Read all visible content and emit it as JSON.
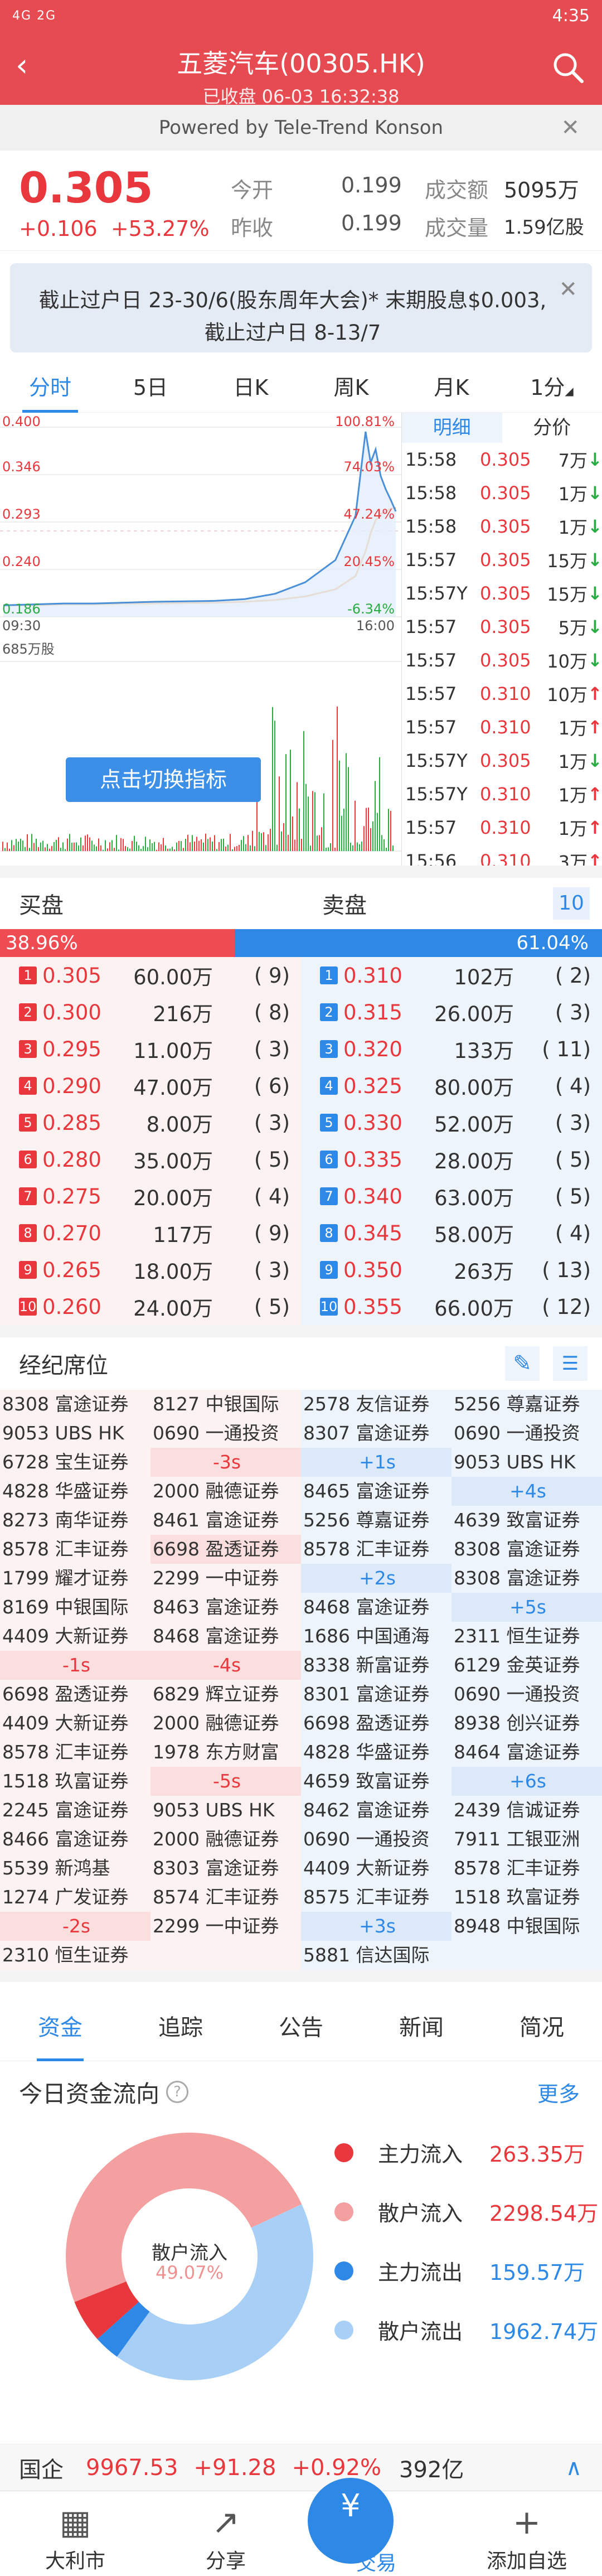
{
  "status_bar": {
    "signal": "4G 2G",
    "time": "4:35"
  },
  "header": {
    "title": "五菱汽车(00305.HK)",
    "subtitle": "已收盘 06-03 16:32:38"
  },
  "powered": {
    "text": "Powered by Tele-Trend Konson"
  },
  "quote": {
    "price": "0.305",
    "change": "+0.106",
    "change_pct": "+53.27%",
    "open_label": "今开",
    "open": "0.199",
    "prev_label": "昨收",
    "prev": "0.199",
    "turnover_label": "成交额",
    "turnover": "5095万",
    "volume_label": "成交量",
    "volume": "1.59亿股"
  },
  "notice": {
    "text": "截止过户日 23-30/6(股东周年大会)* 末期股息$0.003,截止过户日 8-13/7"
  },
  "kline_tabs": [
    "分时",
    "5日",
    "日K",
    "周K",
    "月K",
    "1分"
  ],
  "chart_data": {
    "type": "line",
    "y_labels": [
      "0.400",
      "0.346",
      "0.293",
      "0.240",
      "0.186"
    ],
    "pct_labels": [
      "100.81%",
      "74.03%",
      "47.24%",
      "20.45%",
      "-6.34%"
    ],
    "x_labels": [
      "09:30",
      "16:00"
    ],
    "ylim": [
      0.186,
      0.4
    ],
    "series": [
      {
        "name": "price",
        "color": "#4a90d9",
        "x": [
          "09:30",
          "10:00",
          "10:30",
          "11:00",
          "11:30",
          "12:00",
          "13:00",
          "13:30",
          "14:00",
          "14:30",
          "15:00",
          "15:20",
          "15:30",
          "15:35",
          "15:40",
          "15:45",
          "15:50",
          "15:55",
          "16:00"
        ],
        "values": [
          0.199,
          0.2,
          0.201,
          0.201,
          0.202,
          0.203,
          0.204,
          0.206,
          0.212,
          0.225,
          0.25,
          0.3,
          0.395,
          0.36,
          0.375,
          0.345,
          0.33,
          0.318,
          0.305
        ]
      },
      {
        "name": "avg",
        "color": "#f0a040",
        "x": [
          "09:30",
          "10:00",
          "10:30",
          "11:00",
          "11:30",
          "12:00",
          "13:00",
          "13:30",
          "14:00",
          "14:30",
          "15:00",
          "15:20",
          "15:30",
          "15:35",
          "15:40",
          "15:45",
          "15:50",
          "15:55",
          "16:00"
        ],
        "values": [
          0.199,
          0.199,
          0.2,
          0.2,
          0.201,
          0.201,
          0.202,
          0.203,
          0.205,
          0.209,
          0.217,
          0.232,
          0.26,
          0.28,
          0.295,
          0.302,
          0.305,
          0.308,
          0.309
        ]
      }
    ],
    "volume_label": "685万股"
  },
  "ticks_tabs": {
    "detail": "明细",
    "price": "分价"
  },
  "ticks": [
    {
      "t": "15:58",
      "p": "0.305",
      "v": "7万",
      "d": "↓"
    },
    {
      "t": "15:58",
      "p": "0.305",
      "v": "1万",
      "d": "↓"
    },
    {
      "t": "15:58",
      "p": "0.305",
      "v": "1万",
      "d": "↓"
    },
    {
      "t": "15:57",
      "p": "0.305",
      "v": "15万",
      "d": "↓"
    },
    {
      "t": "15:57Y",
      "p": "0.305",
      "v": "15万",
      "d": "↓"
    },
    {
      "t": "15:57",
      "p": "0.305",
      "v": "5万",
      "d": "↓"
    },
    {
      "t": "15:57",
      "p": "0.305",
      "v": "10万",
      "d": "↓"
    },
    {
      "t": "15:57",
      "p": "0.310",
      "v": "10万",
      "d": "↑"
    },
    {
      "t": "15:57",
      "p": "0.310",
      "v": "1万",
      "d": "↑"
    },
    {
      "t": "15:57Y",
      "p": "0.305",
      "v": "1万",
      "d": "↓"
    },
    {
      "t": "15:57Y",
      "p": "0.310",
      "v": "1万",
      "d": "↑"
    },
    {
      "t": "15:57",
      "p": "0.310",
      "v": "1万",
      "d": "↑"
    },
    {
      "t": "15:56",
      "p": "0.310",
      "v": "3万",
      "d": "↑"
    }
  ],
  "switch_indicator": "点击切换指标",
  "orderbook": {
    "buy_label": "买盘",
    "sell_label": "卖盘",
    "depth": "10",
    "buy_pct": "38.96%",
    "sell_pct": "61.04%",
    "buy_ratio": 0.3896,
    "bids": [
      {
        "lv": "1",
        "price": "0.305",
        "vol": "60.00万",
        "cnt": "9"
      },
      {
        "lv": "2",
        "price": "0.300",
        "vol": "216万",
        "cnt": "8"
      },
      {
        "lv": "3",
        "price": "0.295",
        "vol": "11.00万",
        "cnt": "3"
      },
      {
        "lv": "4",
        "price": "0.290",
        "vol": "47.00万",
        "cnt": "6"
      },
      {
        "lv": "5",
        "price": "0.285",
        "vol": "8.00万",
        "cnt": "3"
      },
      {
        "lv": "6",
        "price": "0.280",
        "vol": "35.00万",
        "cnt": "5"
      },
      {
        "lv": "7",
        "price": "0.275",
        "vol": "20.00万",
        "cnt": "4"
      },
      {
        "lv": "8",
        "price": "0.270",
        "vol": "117万",
        "cnt": "9"
      },
      {
        "lv": "9",
        "price": "0.265",
        "vol": "18.00万",
        "cnt": "3"
      },
      {
        "lv": "10",
        "price": "0.260",
        "vol": "24.00万",
        "cnt": "5"
      }
    ],
    "asks": [
      {
        "lv": "1",
        "price": "0.310",
        "vol": "102万",
        "cnt": "2"
      },
      {
        "lv": "2",
        "price": "0.315",
        "vol": "26.00万",
        "cnt": "3"
      },
      {
        "lv": "3",
        "price": "0.320",
        "vol": "133万",
        "cnt": "11"
      },
      {
        "lv": "4",
        "price": "0.325",
        "vol": "80.00万",
        "cnt": "4"
      },
      {
        "lv": "5",
        "price": "0.330",
        "vol": "52.00万",
        "cnt": "3"
      },
      {
        "lv": "6",
        "price": "0.335",
        "vol": "28.00万",
        "cnt": "5"
      },
      {
        "lv": "7",
        "price": "0.340",
        "vol": "63.00万",
        "cnt": "5"
      },
      {
        "lv": "8",
        "price": "0.345",
        "vol": "58.00万",
        "cnt": "4"
      },
      {
        "lv": "9",
        "price": "0.350",
        "vol": "263万",
        "cnt": "13"
      },
      {
        "lv": "10",
        "price": "0.355",
        "vol": "66.00万",
        "cnt": "12"
      }
    ]
  },
  "brokers": {
    "title": "经纪席位",
    "columns": [
      [
        "8308 富途证券",
        "9053 UBS HK",
        "6728 宝生证券",
        "4828 华盛证券",
        "8273 南华证券",
        "8578 汇丰证券",
        "1799 耀才证券",
        "8169 中银国际",
        "4409 大新证券",
        "-1s",
        "6698 盈透证券",
        "4409 大新证券",
        "8578 汇丰证券",
        "1518 玖富证券",
        "2245 富途证券",
        "8466 富途证券",
        "5539 新鸿基",
        "1274 广发证券",
        "-2s",
        "2310 恒生证券"
      ],
      [
        "8127 中银国际",
        "0690 一通投资",
        "-3s",
        "2000 融德证券",
        "8461 富途证券",
        "6698 盈透证券",
        "2299 一中证券",
        "8463 富途证券",
        "8468 富途证券",
        "-4s",
        "6829 辉立证券",
        "2000 融德证券",
        "1978 东方财富",
        "-5s",
        "9053 UBS HK",
        "2000 融德证券",
        "8303 富途证券",
        "8574 汇丰证券",
        "2299 一中证券",
        ""
      ],
      [
        "2578 友信证券",
        "8307 富途证券",
        "+1s",
        "8465 富途证券",
        "5256 尊嘉证券",
        "8578 汇丰证券",
        "+2s",
        "8468 富途证券",
        "1686 中国通海",
        "8338 新富证券",
        "8301 富途证券",
        "6698 盈透证券",
        "4828 华盛证券",
        "4659 致富证券",
        "8462 富途证券",
        "0690 一通投资",
        "4409 大新证券",
        "8575 汇丰证券",
        "+3s",
        "5881 信达国际"
      ],
      [
        "5256 尊嘉证券",
        "0690 一通投资",
        "9053 UBS HK",
        "+4s",
        "4639 致富证券",
        "8308 富途证券",
        "8308 富途证券",
        "+5s",
        "2311 恒生证券",
        "6129 金英证券",
        "0690 一通投资",
        "8938 创兴证券",
        "8464 富途证券",
        "+6s",
        "2439 信诚证券",
        "7911 工银亚洲",
        "8578 汇丰证券",
        "1518 玖富证券",
        "8948 中银国际",
        ""
      ]
    ]
  },
  "sub_tabs": [
    "资金",
    "追踪",
    "公告",
    "新闻",
    "简况"
  ],
  "flow": {
    "title": "今日资金流向",
    "more": "更多",
    "center_label": "散户流入",
    "center_pct": "49.07%",
    "legend": [
      {
        "label": "主力流入",
        "value": "263.35万",
        "color": "#e8383d"
      },
      {
        "label": "散户流入",
        "value": "2298.54万",
        "color": "#f5a0a0"
      },
      {
        "label": "主力流出",
        "value": "159.57万",
        "color": "#2d88e6"
      },
      {
        "label": "散户流出",
        "value": "1962.74万",
        "color": "#a8cff5"
      }
    ]
  },
  "index_bar": {
    "name": "国企",
    "value": "9967.53",
    "change": "+91.28",
    "pct": "+0.92%",
    "turnover": "392亿"
  },
  "bottom_nav": {
    "home": "大利市",
    "share": "分享",
    "trade": "交易",
    "add": "添加自选"
  }
}
